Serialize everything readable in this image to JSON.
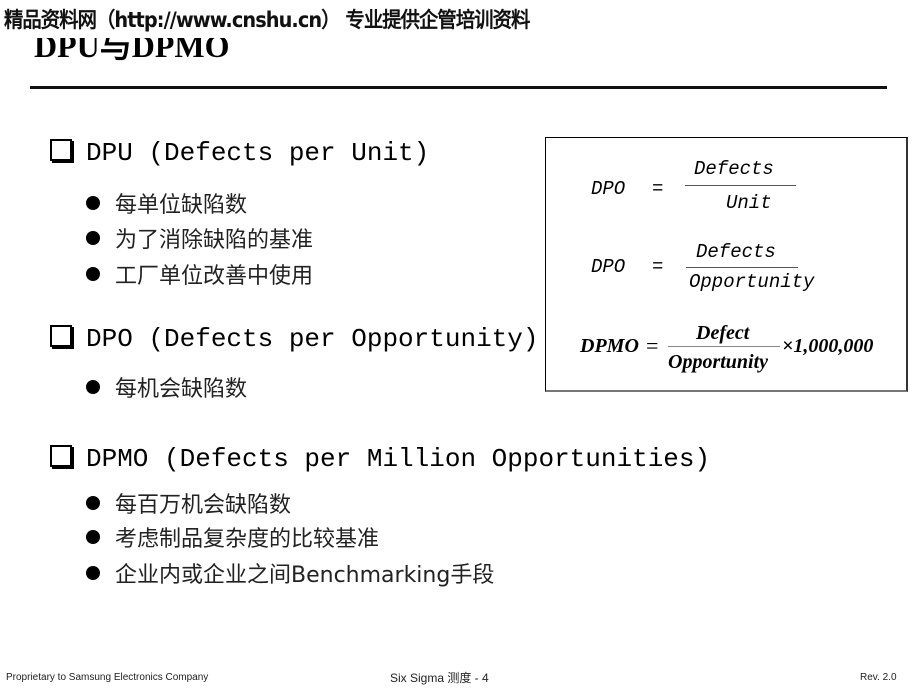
{
  "watermark": "精品资料网（http://www.cnshu.cn） 专业提供企管培训资料",
  "title": "DPU与DPMO",
  "sections": [
    {
      "heading": "DPU (Defects per Unit)",
      "bullets": [
        "每单位缺陷数",
        "为了消除缺陷的基准",
        "工厂单位改善中使用"
      ]
    },
    {
      "heading": "DPO (Defects per Opportunity)",
      "bullets": [
        "每机会缺陷数"
      ]
    },
    {
      "heading": "DPMO (Defects per Million Opportunities)",
      "bullets": [
        "每百万机会缺陷数",
        "考虑制品复杂度的比较基准",
        "企业内或企业之间Benchmarking手段"
      ]
    }
  ],
  "formulas": {
    "f1": {
      "lhs": "DPO",
      "eq": "=",
      "numerator": "Defects",
      "denominator": "Unit"
    },
    "f2": {
      "lhs": "DPO",
      "eq": "=",
      "numerator": "Defects",
      "denominator": "Opportunity"
    },
    "f3": {
      "lhs": "DPMO",
      "eq": "=",
      "numerator": "Defect",
      "denominator": "Opportunity",
      "multiplier": "×1,000,000"
    }
  },
  "footer": {
    "left": "Proprietary to Samsung Electronics Company",
    "center": "Six Sigma  测度 - 4",
    "right": "Rev. 2.0"
  }
}
